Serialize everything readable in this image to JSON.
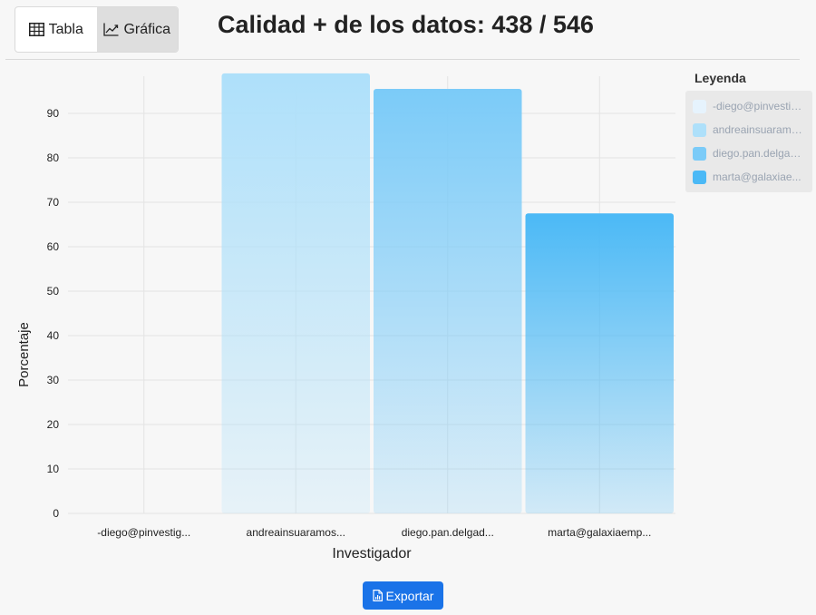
{
  "view_toggle": {
    "table_label": "Tabla",
    "chart_label": "Gráfica"
  },
  "title": "Calidad + de los datos: 438 / 546",
  "legend": {
    "title": "Leyenda",
    "items": [
      {
        "label": "-diego@pinvestig...",
        "color": "#e6f3fd"
      },
      {
        "label": "andreainsuaramos...",
        "color": "#aee0fa"
      },
      {
        "label": "diego.pan.delgad...",
        "color": "#7bcbf8"
      },
      {
        "label": "marta@galaxiae...",
        "color": "#4bb9f6"
      }
    ]
  },
  "chart_data": {
    "type": "bar",
    "categories": [
      "-diego@pinvestig...",
      "andreainsuaramos...",
      "diego.pan.delgad...",
      "marta@galaxiaemp..."
    ],
    "values": [
      0,
      99,
      95.5,
      67.5
    ],
    "colors": [
      "#e6f3fd",
      "#aee0fa",
      "#7bcbf8",
      "#4bb9f6"
    ],
    "xlabel": "Investigador",
    "ylabel": "Porcentaje",
    "ylim": [
      0,
      100
    ],
    "yticks": [
      0,
      10,
      20,
      30,
      40,
      50,
      60,
      70,
      80,
      90
    ],
    "grid": true,
    "legend_position": "right"
  },
  "export_button": {
    "label": "Exportar"
  }
}
